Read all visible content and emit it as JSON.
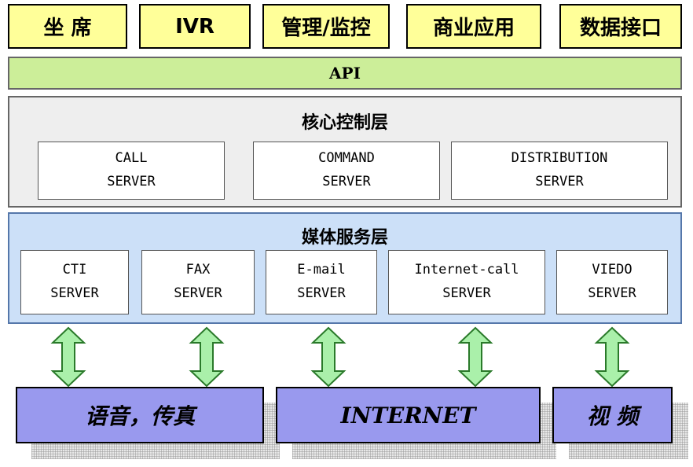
{
  "top_blocks": [
    "坐 席",
    "IVR",
    "管理/监控",
    "商业应用",
    "数据接口"
  ],
  "api": "API",
  "core_layer": {
    "title": "核心控制层",
    "servers": [
      {
        "line1": "CALL",
        "line2": "SERVER"
      },
      {
        "line1": "COMMAND",
        "line2": "SERVER"
      },
      {
        "line1": "DISTRIBUTION",
        "line2": "SERVER"
      }
    ]
  },
  "media_layer": {
    "title": "媒体服务层",
    "servers": [
      {
        "line1": "CTI",
        "line2": "SERVER"
      },
      {
        "line1": "FAX",
        "line2": "SERVER"
      },
      {
        "line1": "E-mail",
        "line2": "SERVER"
      },
      {
        "line1": "Internet-call",
        "line2": "SERVER"
      },
      {
        "line1": "VIEDO",
        "line2": "SERVER"
      }
    ]
  },
  "bottom_blocks": [
    "语音，传真",
    "INTERNET",
    "视 频"
  ],
  "colors": {
    "top": "#ffff99",
    "api": "#ccee99",
    "core": "#eeeeee",
    "media": "#cce0f8",
    "bottom": "#9999ee",
    "arrow": "#aaf0aa"
  }
}
